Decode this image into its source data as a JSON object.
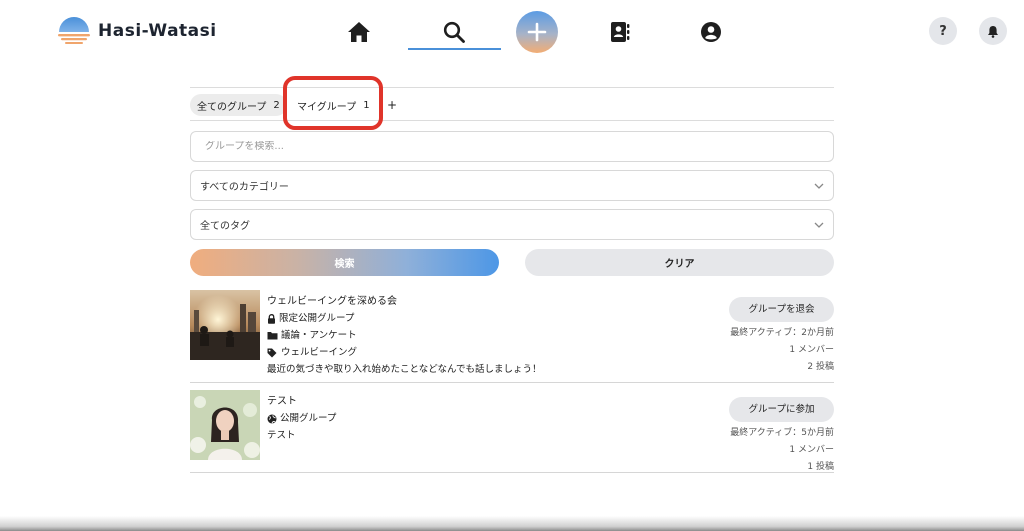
{
  "app": {
    "name": "Hasi-Watasi"
  },
  "header": {
    "nav": [
      {
        "name": "home",
        "icon": "home-icon"
      },
      {
        "name": "search",
        "icon": "search-icon",
        "active": true
      },
      {
        "name": "create",
        "icon": "plus-icon"
      },
      {
        "name": "contacts",
        "icon": "contact-book-icon"
      },
      {
        "name": "profile",
        "icon": "user-circle-icon"
      }
    ],
    "help_label": "?",
    "notification_icon": "bell-icon",
    "accent": "#4a90d9"
  },
  "tabs": {
    "items": [
      {
        "label": "全てのグループ",
        "count": "2"
      },
      {
        "label": "マイグループ",
        "count": "1"
      }
    ],
    "add_label": "+",
    "highlight_color": "#e0342a"
  },
  "search": {
    "placeholder": "グループを検索...",
    "category_select": "すべてのカテゴリー",
    "tag_select": "全てのタグ",
    "search_button": "検索",
    "clear_button": "クリア"
  },
  "groups": [
    {
      "title": "ウェルビーイングを深める会",
      "visibility": "限定公開グループ",
      "visibility_icon": "lock-icon",
      "category": "議論・アンケート",
      "category_icon": "folder-icon",
      "tag": "ウェルビーイング",
      "tag_icon": "tag-icon",
      "description": "最近の気づきや取り入れ始めたことなどなんでも話しましょう！",
      "action": "グループを退会",
      "last_active": "最終アクティブ：2か月前",
      "members": "1 メンバー",
      "posts": "2 投稿"
    },
    {
      "title": "テスト",
      "visibility": "公開グループ",
      "visibility_icon": "globe-icon",
      "description": "テスト",
      "action": "グループに参加",
      "last_active": "最終アクティブ：5か月前",
      "members": "1 メンバー",
      "posts": "1 投稿"
    }
  ]
}
